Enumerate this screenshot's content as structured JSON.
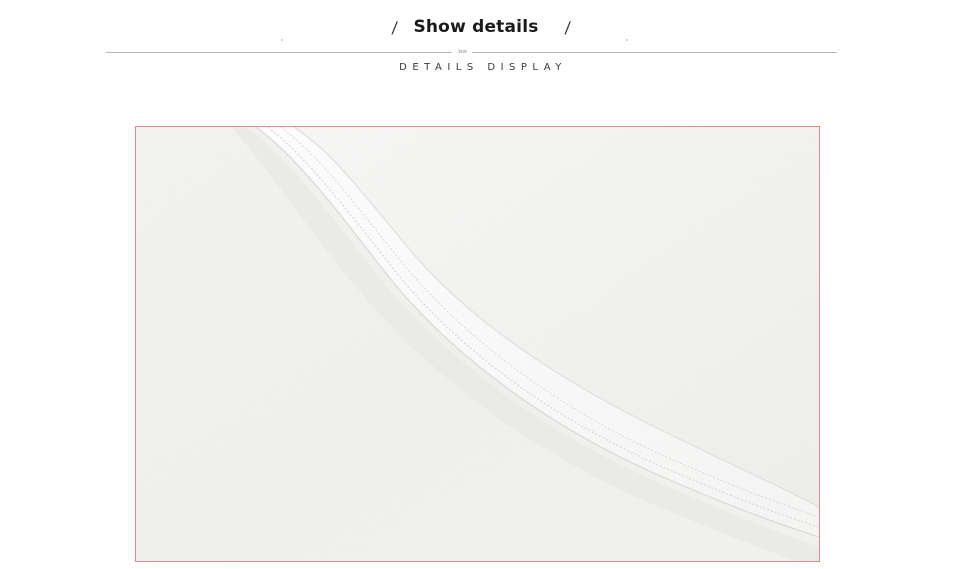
{
  "header": {
    "left_slash": "/",
    "title": "Show details",
    "right_slash": "/",
    "divider_arrows": "»»",
    "subtitle": "DETAILS DISPLAY"
  },
  "photo": {
    "subject": "white-fabric-neckline-closeup",
    "frame_color": "#e08a8a"
  }
}
